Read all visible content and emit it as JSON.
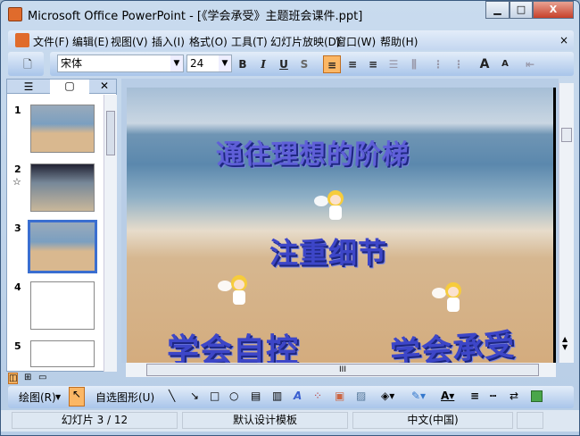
{
  "window": {
    "title": "Microsoft Office PowerPoint - [《学会承受》主题班会课件.ppt]",
    "minimize": "▁",
    "maximize": "□",
    "close": "X"
  },
  "menu": [
    "文件(F)",
    "编辑(E)",
    "视图(V)",
    "插入(I)",
    "格式(O)",
    "工具(T)",
    "幻灯片放映(D)",
    "窗口(W)",
    "帮助(H)"
  ],
  "menu_close": "×",
  "toolbar": {
    "font": "宋体",
    "size": "24",
    "bold": "B",
    "italic": "I",
    "underline": "U",
    "shadow": "S",
    "grow": "A",
    "shrink": "A"
  },
  "slides": [
    {
      "num": "1"
    },
    {
      "num": "2",
      "star": "☆"
    },
    {
      "num": "3"
    },
    {
      "num": "4"
    },
    {
      "num": "5"
    }
  ],
  "slide": {
    "title": "通往理想的阶梯",
    "sub": "注重细节",
    "left": "学会自控",
    "right": "学会承受"
  },
  "hscroll_thumb": "III",
  "drawing": {
    "draw": "绘图(R)",
    "autoshapes": "自选图形(U)"
  },
  "status": {
    "slide": "幻灯片 3 / 12",
    "template": "默认设计模板",
    "language": "中文(中国)"
  }
}
